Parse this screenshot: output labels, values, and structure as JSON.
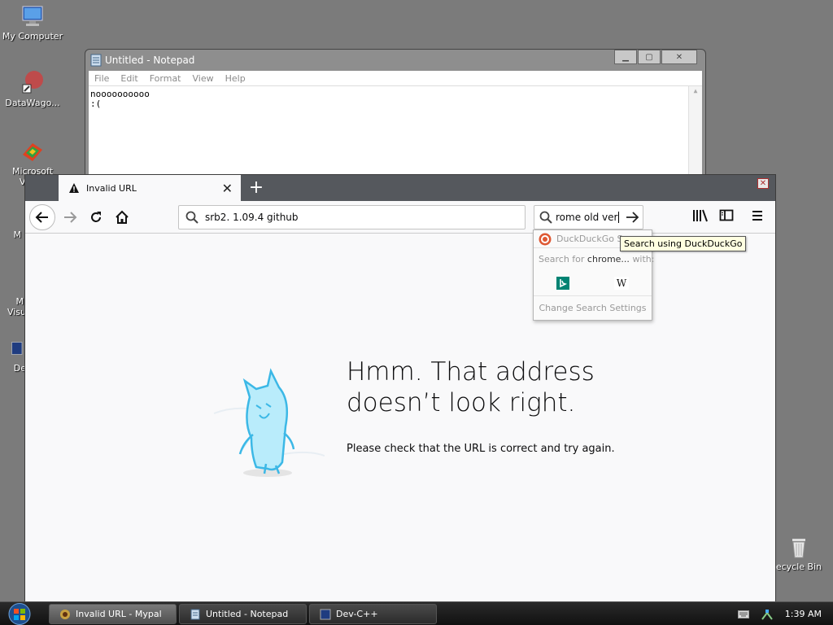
{
  "desktop": {
    "icons": [
      {
        "label": "My Computer"
      },
      {
        "label": "DataWago..."
      },
      {
        "label": "Microsoft"
      },
      {
        "label": "Vis"
      },
      {
        "label": "M"
      },
      {
        "label": "Mi"
      },
      {
        "label": "Visu"
      },
      {
        "label": "De"
      },
      {
        "label": "ecycle Bin"
      }
    ]
  },
  "notepad": {
    "title": "Untitled - Notepad",
    "menu": [
      "File",
      "Edit",
      "Format",
      "View",
      "Help"
    ],
    "text": "noooooooooo\n:("
  },
  "browser": {
    "tab_title": "Invalid URL",
    "url_value": "srb2. 1.09.4 github",
    "search_value": "rome old ver",
    "error_title": "Hmm. That address doesn’t look right.",
    "error_desc": "Please check that the URL is correct and try again.",
    "search_dropdown": {
      "engine_header": "DuckDuckGo S",
      "search_for": "Search for",
      "query": "chrome...",
      "with": "with:",
      "engines": [
        "bing-icon",
        "wikipedia-icon"
      ],
      "settings": "Change Search Settings"
    },
    "tooltip": "Search using DuckDuckGo"
  },
  "taskbar": {
    "items": [
      {
        "label": "Invalid URL - Mypal"
      },
      {
        "label": "Untitled - Notepad"
      },
      {
        "label": "Dev-C++"
      }
    ],
    "clock": "1:39 AM"
  }
}
